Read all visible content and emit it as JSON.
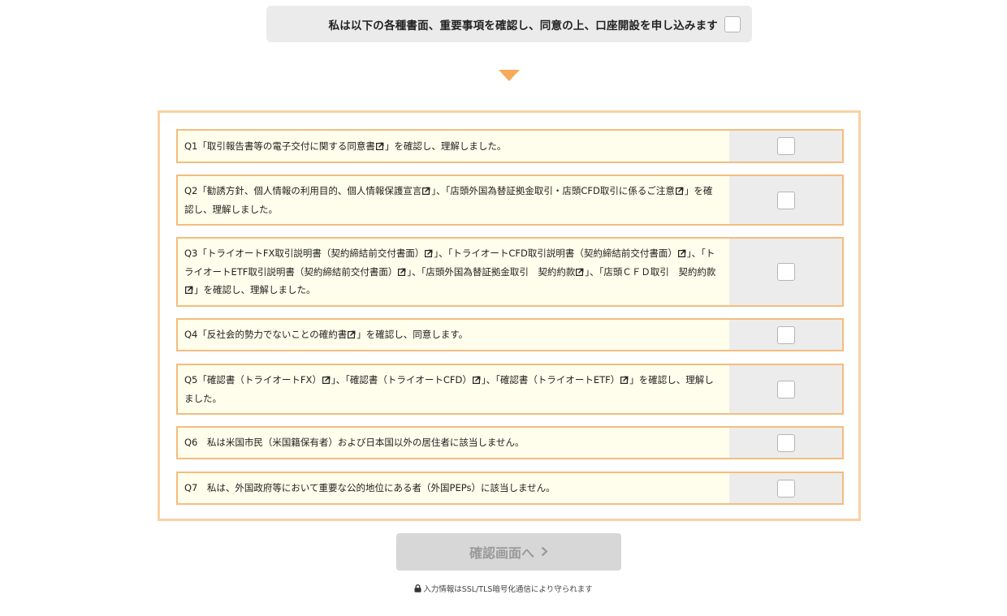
{
  "consent": {
    "text": "私は以下の各種書面、重要事項を確認し、同意の上、口座開設を申し込みます",
    "checked": false
  },
  "questions": [
    {
      "id": "Q1",
      "segments": [
        {
          "t": "Q1「取引報告書等の電子交付に関する同意書"
        },
        {
          "icon": "external-link-icon"
        },
        {
          "t": "」を確認し、理解しました。"
        }
      ],
      "checked": false
    },
    {
      "id": "Q2",
      "segments": [
        {
          "t": "Q2「勧誘方針、個人情報の利用目的、個人情報保護宣言"
        },
        {
          "icon": "external-link-icon"
        },
        {
          "t": "」、「店頭外国為替証拠金取引・店頭CFD取引に係るご注意"
        },
        {
          "icon": "external-link-icon"
        },
        {
          "t": "」を確認し、理解しました。"
        }
      ],
      "checked": false
    },
    {
      "id": "Q3",
      "segments": [
        {
          "t": "Q3「トライオートFX取引説明書（契約締結前交付書面）"
        },
        {
          "icon": "external-link-icon"
        },
        {
          "t": "」、「トライオートCFD取引説明書（契約締結前交付書面）"
        },
        {
          "icon": "external-link-icon"
        },
        {
          "t": "」、「トライオートETF取引説明書（契約締結前交付書面）"
        },
        {
          "icon": "external-link-icon"
        },
        {
          "t": "」、「店頭外国為替証拠金取引　契約約款"
        },
        {
          "icon": "external-link-icon"
        },
        {
          "t": "」、「店頭ＣＦＤ取引　契約約款"
        },
        {
          "icon": "external-link-icon"
        },
        {
          "t": "」を確認し、理解しました。"
        }
      ],
      "checked": false
    },
    {
      "id": "Q4",
      "segments": [
        {
          "t": "Q4「反社会的勢力でないことの確約書"
        },
        {
          "icon": "external-link-icon"
        },
        {
          "t": "」を確認し、同意します。"
        }
      ],
      "checked": false
    },
    {
      "id": "Q5",
      "segments": [
        {
          "t": "Q5「確認書（トライオートFX）"
        },
        {
          "icon": "external-link-icon"
        },
        {
          "t": "」、「確認書（トライオートCFD）"
        },
        {
          "icon": "external-link-icon"
        },
        {
          "t": "」、「確認書（トライオートETF）"
        },
        {
          "icon": "external-link-icon"
        },
        {
          "t": "」を確認し、理解しました。"
        }
      ],
      "checked": false
    },
    {
      "id": "Q6",
      "segments": [
        {
          "t": "Q6　私は米国市民（米国籍保有者）および日本国以外の居住者に該当しません。"
        }
      ],
      "checked": false
    },
    {
      "id": "Q7",
      "segments": [
        {
          "t": "Q7　私は、外国政府等において重要な公的地位にある者（外国PEPs）に該当しません。"
        }
      ],
      "checked": false
    }
  ],
  "submit": {
    "label": "確認画面へ",
    "icon": "chevron-right-icon",
    "enabled": false
  },
  "footer": {
    "ssl_text": "入力情報はSSL/TLS暗号化通信により守られます",
    "icon": "lock-icon"
  },
  "colors": {
    "accent": "#f6aa5c",
    "panel_border": "#f9d1a3",
    "row_border": "#f3bd7f",
    "row_bg": "#fffdeb",
    "check_cell_bg": "#ececec",
    "button_disabled_bg": "#d7d7d7",
    "button_disabled_text": "#9a9a9a"
  }
}
